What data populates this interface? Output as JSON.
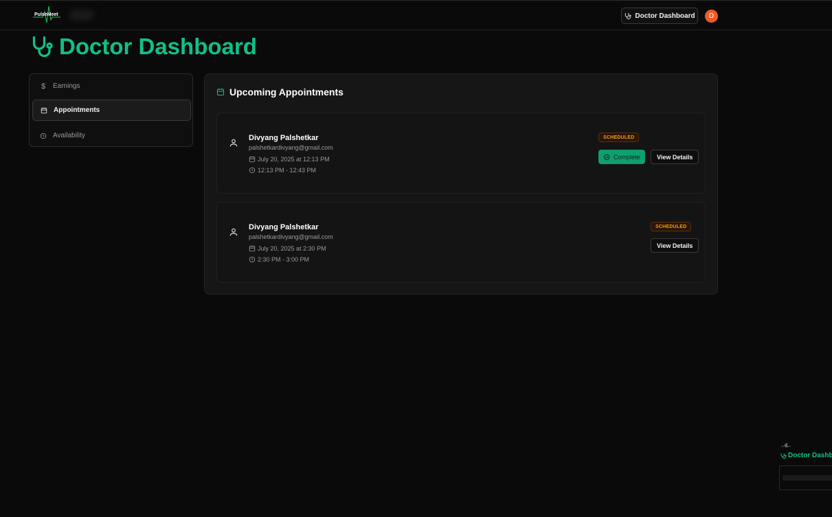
{
  "header": {
    "logo_text": "PulseMeet",
    "nav_button_label": "Doctor Dashboard",
    "avatar_initial": "D"
  },
  "page": {
    "title": "Doctor Dashboard",
    "accent_color": "#10c08a"
  },
  "sidebar": {
    "items": [
      {
        "label": "Earnings",
        "icon": "dollar-icon",
        "active": false
      },
      {
        "label": "Appointments",
        "icon": "calendar-icon",
        "active": true
      },
      {
        "label": "Availability",
        "icon": "clock-icon",
        "active": false
      }
    ]
  },
  "appointments": {
    "title": "Upcoming Appointments",
    "items": [
      {
        "name": "Divyang Palshetkar",
        "email": "palshetkardivyang@gmail.com",
        "date": "July 20, 2025 at 12:13 PM",
        "time": "12:13 PM - 12:43 PM",
        "status": "SCHEDULED",
        "complete_label": "Complete",
        "view_label": "View Details"
      },
      {
        "name": "Divyang Palshetkar",
        "email": "palshetkardivyang@gmail.com",
        "date": "July 20, 2025 at 2:30 PM",
        "time": "2:30 PM - 3:00 PM",
        "status": "SCHEDULED",
        "view_label": "View Details"
      }
    ]
  },
  "colors": {
    "status_scheduled": "#f59e0b",
    "complete_button": "#0f9f6e",
    "avatar": "#f05a28"
  }
}
